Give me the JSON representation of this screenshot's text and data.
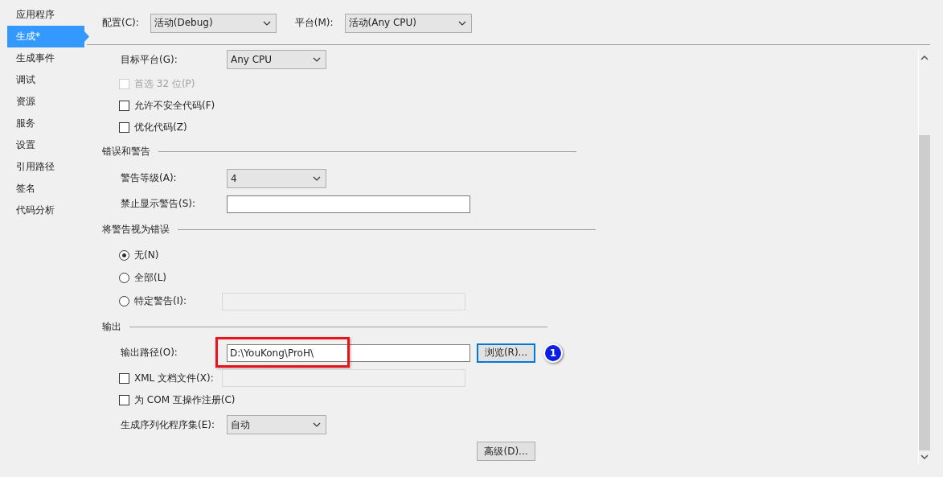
{
  "sidebar": {
    "items": [
      {
        "label": "应用程序",
        "selected": false
      },
      {
        "label": "生成*",
        "selected": true
      },
      {
        "label": "生成事件",
        "selected": false
      },
      {
        "label": "调试",
        "selected": false
      },
      {
        "label": "资源",
        "selected": false
      },
      {
        "label": "服务",
        "selected": false
      },
      {
        "label": "设置",
        "selected": false
      },
      {
        "label": "引用路径",
        "selected": false
      },
      {
        "label": "签名",
        "selected": false
      },
      {
        "label": "代码分析",
        "selected": false
      }
    ]
  },
  "toolbar": {
    "configuration": {
      "label": "配置(C):",
      "value": "活动(Debug)"
    },
    "platform": {
      "label": "平台(M):",
      "value": "活动(Any CPU)"
    }
  },
  "rows": [
    {
      "kind": "dropdown",
      "label": "目标平台(G):",
      "value": "Any CPU"
    },
    {
      "kind": "checkbox",
      "label": "首选 32 位(P)",
      "checked": false,
      "disabled": true
    },
    {
      "kind": "checkbox",
      "label": "允许不安全代码(F)",
      "checked": false,
      "disabled": false
    },
    {
      "kind": "checkbox",
      "label": "优化代码(Z)",
      "checked": false,
      "disabled": false
    },
    {
      "kind": "section",
      "label": "错误和警告"
    },
    {
      "kind": "dropdown",
      "label": "警告等级(A):",
      "value": "4"
    },
    {
      "kind": "textfield",
      "label": "禁止显示警告(S):",
      "disabled": false
    },
    {
      "kind": "section",
      "label": "将警告视为错误"
    },
    {
      "kind": "radio",
      "label": "无(N)",
      "selected": true
    },
    {
      "kind": "radio",
      "label": "全部(L)",
      "selected": false
    },
    {
      "kind": "radio",
      "label": "特定警告(I):",
      "selected": false,
      "field": {
        "disabled": true
      }
    },
    {
      "kind": "section",
      "label": "输出"
    },
    {
      "kind": "textfield",
      "label": "输出路径(O):",
      "value": "D:\\YouKong\\ProH\\",
      "disabled": false,
      "highlighted": true,
      "button": "浏览(R)...",
      "badge": "1"
    },
    {
      "kind": "checkbox",
      "label": "XML 文档文件(X):",
      "checked": false,
      "disabled": false,
      "field": {
        "disabled": true
      }
    },
    {
      "kind": "checkbox",
      "label": "为 COM 互操作注册(C)",
      "checked": false,
      "disabled": false
    },
    {
      "kind": "dropdown",
      "label": "生成序列化程序集(E):",
      "value": "自动"
    },
    {
      "kind": "button",
      "label": "高级(D)..."
    }
  ]
}
